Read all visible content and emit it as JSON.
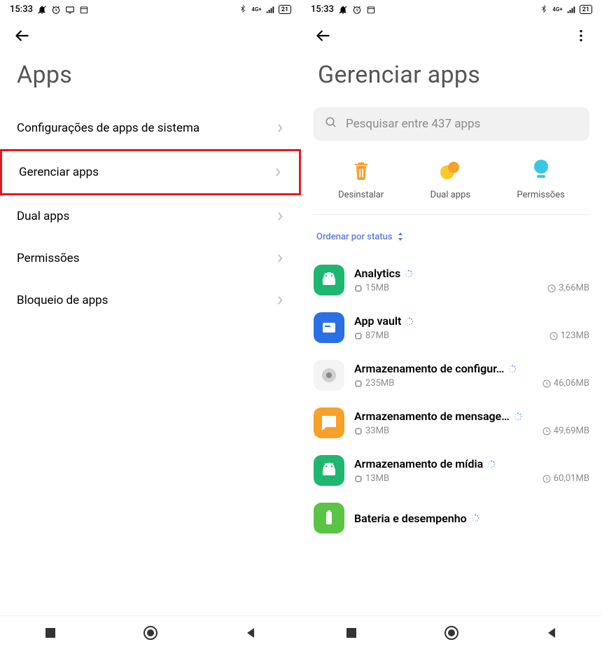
{
  "status": {
    "time": "15:33",
    "network_label": "4G+",
    "battery": "21"
  },
  "screen1": {
    "title": "Apps",
    "items": [
      {
        "label": "Configurações de apps de sistema"
      },
      {
        "label": "Gerenciar apps"
      },
      {
        "label": "Dual apps"
      },
      {
        "label": "Permissões"
      },
      {
        "label": "Bloqueio de apps"
      }
    ]
  },
  "screen2": {
    "title": "Gerenciar apps",
    "search_placeholder": "Pesquisar entre 437 apps",
    "actions": [
      {
        "label": "Desinstalar"
      },
      {
        "label": "Dual apps"
      },
      {
        "label": "Permissões"
      }
    ],
    "sort_label": "Ordenar por status",
    "apps": [
      {
        "name": "Analytics",
        "storage": "15MB",
        "data": "3,66MB",
        "icon_bg": "#1fb770",
        "icon_type": "android"
      },
      {
        "name": "App vault",
        "storage": "87MB",
        "data": "123MB",
        "icon_bg": "#2a6fe6",
        "icon_type": "vault"
      },
      {
        "name": "Armazenamento de configur…",
        "storage": "235MB",
        "data": "46,06MB",
        "icon_bg": "#f4f4f4",
        "icon_type": "gear"
      },
      {
        "name": "Armazenamento de mensage…",
        "storage": "33MB",
        "data": "49,69MB",
        "icon_bg": "#f7a02a",
        "icon_type": "message"
      },
      {
        "name": "Armazenamento de mídia",
        "storage": "13MB",
        "data": "60,01MB",
        "icon_bg": "#1fb770",
        "icon_type": "android"
      },
      {
        "name": "Bateria e desempenho",
        "storage": "",
        "data": "",
        "icon_bg": "#5ac445",
        "icon_type": "battery"
      }
    ]
  }
}
